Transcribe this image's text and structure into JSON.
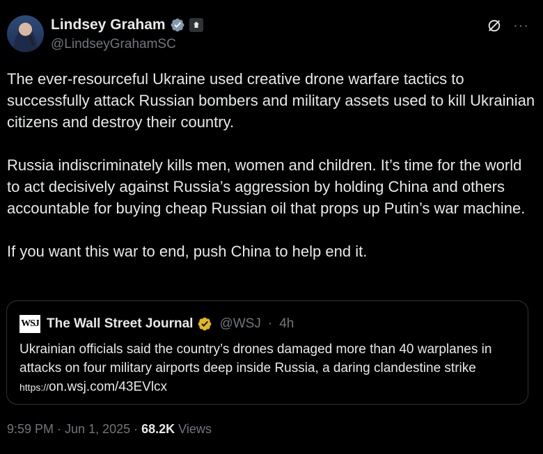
{
  "author": {
    "name": "Lindsey Graham",
    "handle": "@LindseyGrahamSC"
  },
  "tweet": {
    "paragraphs": [
      "The ever-resourceful Ukraine used creative drone warfare tactics to successfully attack Russian bombers and military assets used to kill Ukrainian citizens and destroy their country.",
      "Russia indiscriminately kills men, women and children. It’s time for the world to act decisively against Russia’s aggression by holding China and others accountable for buying cheap Russian oil that props up Putin’s war machine.",
      "If you want this war to end, push China to help end it."
    ]
  },
  "quote": {
    "logo": "WSJ",
    "name": "The Wall Street Journal",
    "handle": "@WSJ",
    "separator": "·",
    "time": "4h",
    "text": "Ukrainian officials said the country’s drones damaged more than 40 warplanes in attacks on four military airports deep inside Russia, a daring clandestine strike",
    "link_prefix": "https://",
    "link": "on.wsj.com/43EVlcx"
  },
  "meta": {
    "time": "9:59 PM",
    "dot1": "·",
    "date": "Jun 1, 2025",
    "dot2": "·",
    "views_count": "68.2K",
    "views_label": "Views"
  },
  "icons": {
    "verified_blue": "#1d9bf0",
    "verified_gold": "#e2b719",
    "grok": "grok-icon",
    "more": "more-icon"
  }
}
